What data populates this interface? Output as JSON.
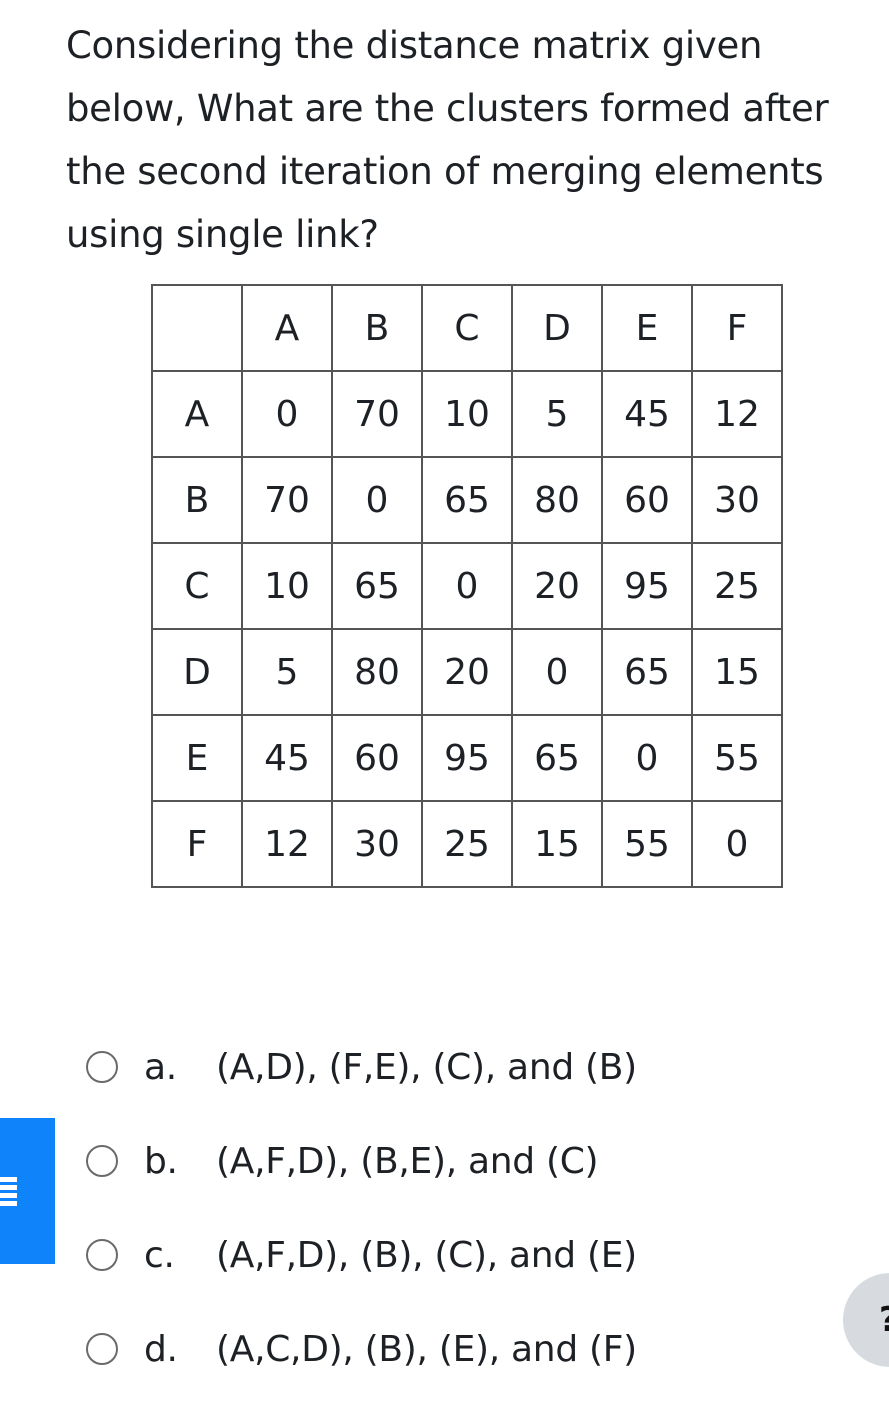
{
  "question": {
    "text": "Considering the distance matrix given below, What are the clusters formed after the second iteration of merging elements using single link?"
  },
  "matrix": {
    "headers": [
      "",
      "A",
      "B",
      "C",
      "D",
      "E",
      "F"
    ],
    "rows": [
      [
        "A",
        "0",
        "70",
        "10",
        "5",
        "45",
        "12"
      ],
      [
        "B",
        "70",
        "0",
        "65",
        "80",
        "60",
        "30"
      ],
      [
        "C",
        "10",
        "65",
        "0",
        "20",
        "95",
        "25"
      ],
      [
        "D",
        "5",
        "80",
        "20",
        "0",
        "65",
        "15"
      ],
      [
        "E",
        "45",
        "60",
        "95",
        "65",
        "0",
        "55"
      ],
      [
        "F",
        "12",
        "30",
        "25",
        "15",
        "55",
        "0"
      ]
    ]
  },
  "options": [
    {
      "letter": "a.",
      "text": "(A,D), (F,E), (C), and (B)"
    },
    {
      "letter": "b.",
      "text": "(A,F,D), (B,E), and (C)"
    },
    {
      "letter": "c.",
      "text": "(A,F,D), (B), (C), and (E)"
    },
    {
      "letter": "d.",
      "text": "(A,C,D), (B), (E), and (F)"
    }
  ],
  "side_tab": {
    "icon": "menu-icon",
    "color": "#0f83f9"
  },
  "help_button": {
    "icon": "help-icon",
    "glyph": "?"
  }
}
